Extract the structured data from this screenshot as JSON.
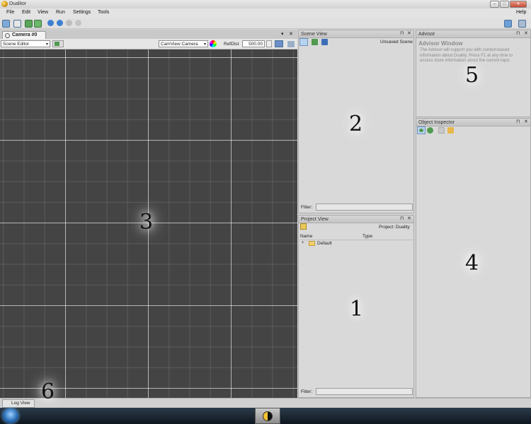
{
  "window": {
    "title": "Dualitor",
    "icon": "yin-yang-icon"
  },
  "menu": {
    "items": [
      "File",
      "Edit",
      "View",
      "Run",
      "Settings",
      "Tools"
    ],
    "help": "Help"
  },
  "toolbar": {
    "icons": [
      "new-icon",
      "save-icon",
      "open-icon",
      "save-all-icon",
      "play-icon",
      "pause-icon",
      "stop-icon",
      "step-icon"
    ]
  },
  "camera_editor": {
    "tab_label": "Camera #0",
    "mode_select": "Scene Editor",
    "camera_select": "CamView Camera",
    "refdist_label": "RefDist",
    "refdist_value": "500.00",
    "region_number": "3"
  },
  "scene_view": {
    "title": "Scene View",
    "status": "Unsaved Scene",
    "filter_label": "Filter:",
    "region_number": "2"
  },
  "project_view": {
    "title": "Project View",
    "project_label": "Project: Duality",
    "col_name": "Name",
    "col_type": "Type",
    "tree_item": "Default",
    "expander": "+",
    "filter_label": "Filter:",
    "region_number": "1"
  },
  "advisor": {
    "title": "Advisor",
    "heading": "Advisor Window",
    "body": "The Advisor will support you with context-based information about Duality.  Press F1 at any time to access more information about the current topic.",
    "region_number": "5"
  },
  "object_inspector": {
    "title": "Object Inspector",
    "region_number": "4"
  },
  "log": {
    "tab_label": "Log View",
    "region_number": "6"
  },
  "glyphs": {
    "pin": "⊓",
    "close": "✕",
    "dropdown": "▾",
    "minimize": "–",
    "maximize": "□"
  }
}
